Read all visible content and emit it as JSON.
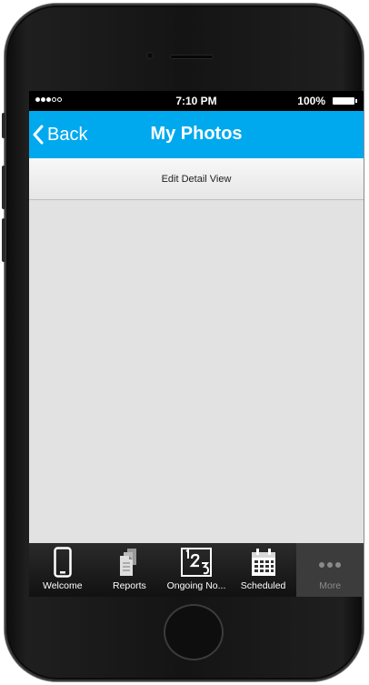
{
  "status_bar": {
    "time": "7:10 PM",
    "battery": "100%",
    "signal": "signal-dots-icon"
  },
  "nav_bar": {
    "back_label": "Back",
    "title": "My Photos",
    "color": "#00a9ee"
  },
  "sub_bar": {
    "label": "Edit Detail View"
  },
  "tab_bar": {
    "items": [
      {
        "label": "Welcome",
        "icon": "phone-icon"
      },
      {
        "label": "Reports",
        "icon": "documents-icon"
      },
      {
        "label": "Ongoing No...",
        "icon": "numbers-icon"
      },
      {
        "label": "Scheduled",
        "icon": "calendar-icon"
      },
      {
        "label": "More",
        "icon": "more-icon",
        "active": true
      }
    ]
  }
}
